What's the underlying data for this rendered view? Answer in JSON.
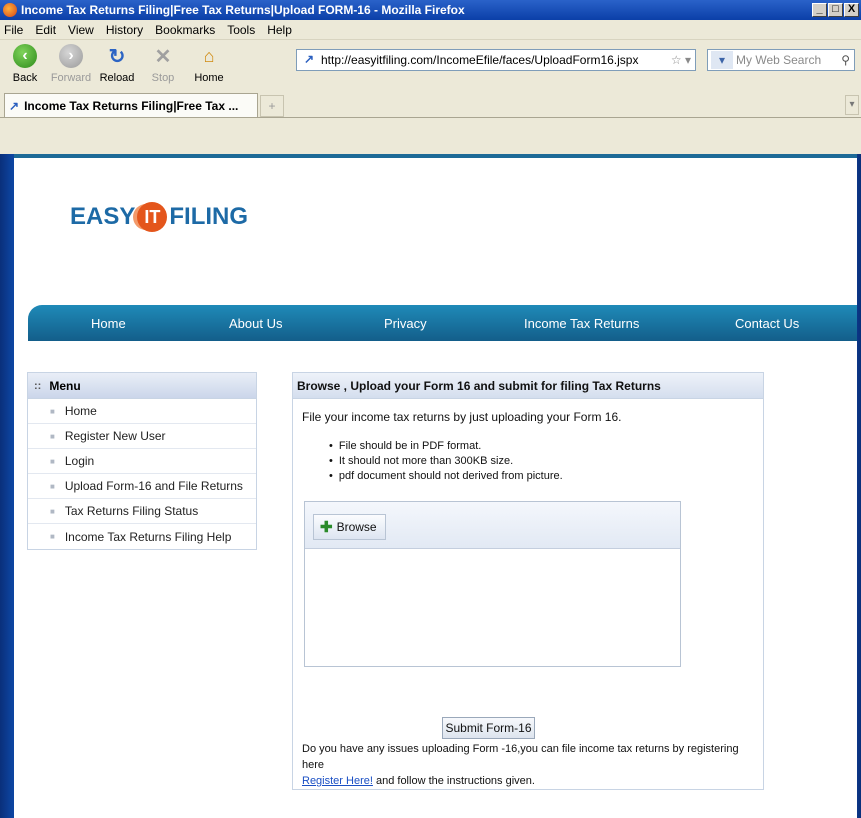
{
  "window": {
    "title": "Income Tax Returns Filing|Free Tax Returns|Upload FORM-16 - Mozilla Firefox",
    "minimize": "_",
    "maximize": "□",
    "close": "X"
  },
  "menubar": [
    "File",
    "Edit",
    "View",
    "History",
    "Bookmarks",
    "Tools",
    "Help"
  ],
  "toolbar": {
    "back": "Back",
    "forward": "Forward",
    "reload": "Reload",
    "stop": "Stop",
    "home": "Home"
  },
  "urlbar": {
    "url": "http://easyitfiling.com/IncomeEfile/faces/UploadForm16.jspx"
  },
  "search": {
    "placeholder": "My Web Search"
  },
  "tabs": [
    {
      "label": "Income Tax Returns Filing|Free Tax ..."
    }
  ],
  "logo": {
    "part1": "EASY",
    "part2": "IT",
    "part3": "FILING"
  },
  "nav": [
    "Home",
    "About Us",
    "Privacy",
    "Income Tax Returns",
    "Contact Us"
  ],
  "sidebar": {
    "title": "Menu",
    "items": [
      "Home",
      "Register New User",
      "Login",
      "Upload Form-16 and File Returns",
      "Tax Returns Filing Status",
      "Income Tax Returns Filing Help"
    ]
  },
  "panel": {
    "title": "Browse , Upload your Form 16 and submit for filing Tax Returns",
    "intro": "File your income tax returns by just uploading your Form 16.",
    "bullets": [
      "File should be in PDF format.",
      "It should not more than 300KB size.",
      "pdf document should not derived from picture."
    ],
    "browse_label": "Browse",
    "submit_label": "Submit Form-16",
    "note": "Do you have any issues uploading Form -16,you can file income tax returns by registering here",
    "register_link": "Register Here!",
    "note_tail": " and follow the instructions given."
  },
  "colors": {
    "nav_bar": "#1f8ab8",
    "logo_blue": "#1d6aa6",
    "logo_orange": "#e4561c",
    "desktop": "#0d44a0"
  }
}
